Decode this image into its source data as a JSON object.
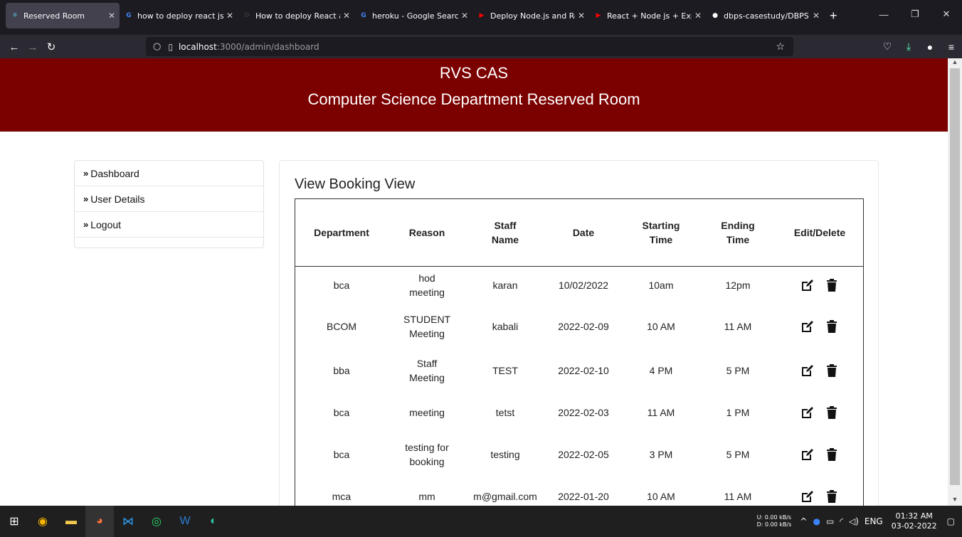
{
  "browser": {
    "tabs": [
      {
        "title": "Reserved Room",
        "icon": "react-icon",
        "color": "#61dafb",
        "glyph": "⚛",
        "active": true
      },
      {
        "title": "how to deploy react js in",
        "icon": "google-icon",
        "color": "#4285f4",
        "glyph": "G"
      },
      {
        "title": "How to deploy React ap",
        "icon": "dev-icon",
        "color": "#333333",
        "glyph": "D"
      },
      {
        "title": "heroku - Google Search",
        "icon": "google-icon",
        "color": "#4285f4",
        "glyph": "G"
      },
      {
        "title": "Deploy Node.js and Rea",
        "icon": "youtube-icon",
        "color": "#ff0000",
        "glyph": "▶"
      },
      {
        "title": "React + Node js + Expre",
        "icon": "youtube-icon",
        "color": "#ff0000",
        "glyph": "▶"
      },
      {
        "title": "dbps-casestudy/DBPS (D",
        "icon": "github-icon",
        "color": "#ffffff",
        "glyph": "●"
      }
    ],
    "url_host": "localhost",
    "url_path": ":3000/admin/dashboard"
  },
  "header": {
    "title": "RVS CAS",
    "subtitle": "Computer Science Department Reserved Room",
    "color": "#7b0000"
  },
  "sidebar": {
    "items": [
      {
        "label": "Dashboard"
      },
      {
        "label": "User Details"
      },
      {
        "label": "Logout"
      }
    ]
  },
  "main": {
    "heading": "View Booking View",
    "columns": [
      "Department",
      "Reason",
      "Staff Name",
      "Date",
      "Starting Time",
      "Ending Time",
      "Edit/Delete"
    ],
    "rows": [
      {
        "department": "bca",
        "reason": "hod meeting",
        "staff": "karan",
        "date": "10/02/2022",
        "start": "10am",
        "end": "12pm"
      },
      {
        "department": "BCOM",
        "reason": "STUDENT Meeting",
        "staff": "kabali",
        "date": "2022-02-09",
        "start": "10 AM",
        "end": "11 AM"
      },
      {
        "department": "bba",
        "reason": "Staff Meeting",
        "staff": "TEST",
        "date": "2022-02-10",
        "start": "4 PM",
        "end": "5 PM"
      },
      {
        "department": "bca",
        "reason": "meeting",
        "staff": "tetst",
        "date": "2022-02-03",
        "start": "11 AM",
        "end": "1 PM"
      },
      {
        "department": "bca",
        "reason": "testing for booking",
        "staff": "testing",
        "date": "2022-02-05",
        "start": "3 PM",
        "end": "5 PM"
      },
      {
        "department": "mca",
        "reason": "mm",
        "staff": "m@gmail.com",
        "date": "2022-01-20",
        "start": "10 AM",
        "end": "11 AM"
      }
    ]
  },
  "taskbar": {
    "net_up": "U:   0.00 kB/s",
    "net_down": "D:   0.00 kB/s",
    "language": "ENG",
    "time": "01:32 AM",
    "date": "03-02-2022"
  }
}
